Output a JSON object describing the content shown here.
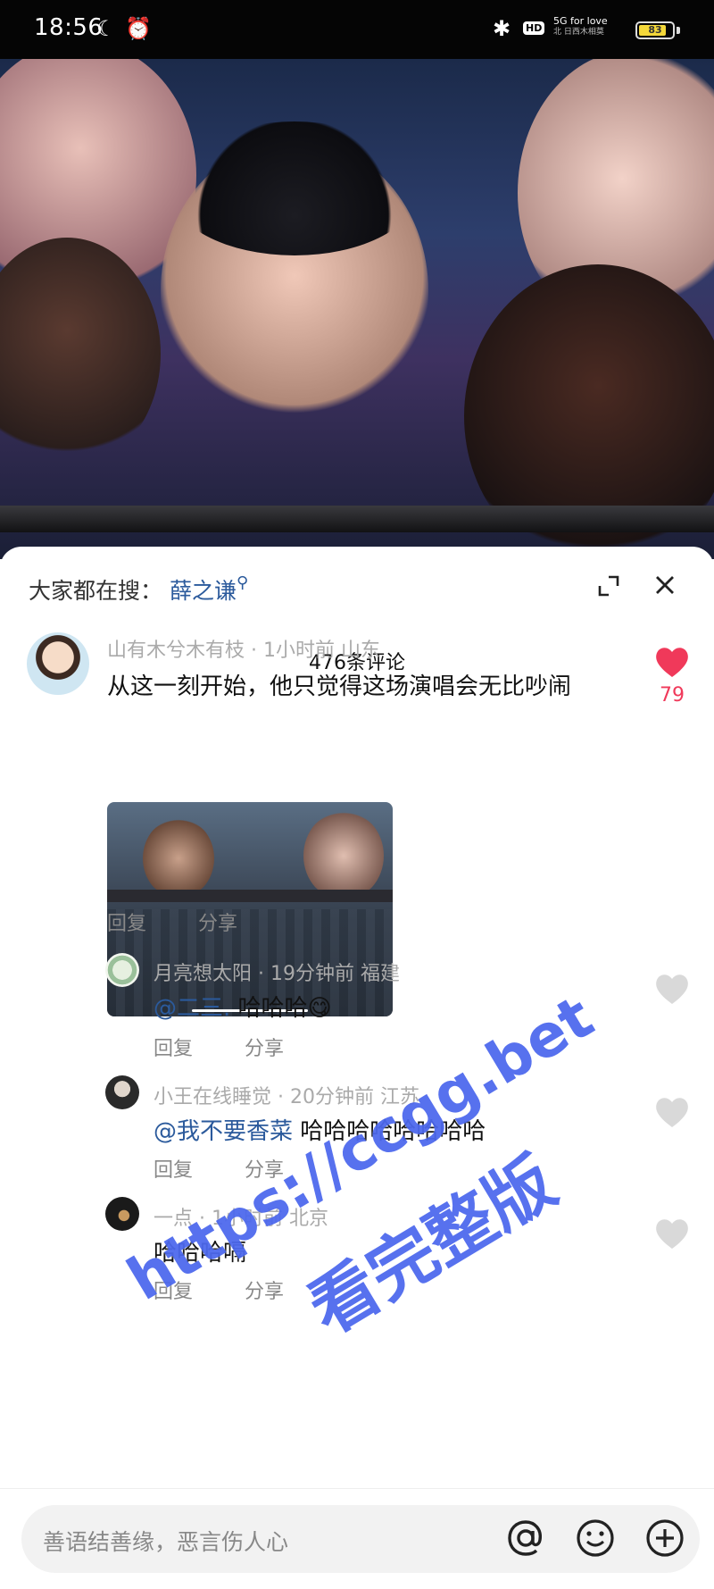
{
  "status_bar": {
    "time": "18:56",
    "hd": "HD",
    "network_top": "5G for love",
    "network_bottom": "北 日西木相莫",
    "battery": "83",
    "battery_level": 0.83
  },
  "panel": {
    "search_prefix": "大家都在搜：",
    "search_keyword": "薛之谦",
    "comment_count": "476条评论"
  },
  "comments": [
    {
      "meta": "山有木兮木有枝 · 1小时前 山东",
      "text": "从这一刻开始，他只觉得这场演唱会无比吵闹",
      "likes": "79",
      "reply": "回复",
      "share": "分享"
    }
  ],
  "replies": [
    {
      "meta": "月亮想太阳 · 19分钟前 福建",
      "mention": "@二三.",
      "text": " 哈哈哈",
      "emoji": "😋",
      "reply": "回复",
      "share": "分享"
    },
    {
      "meta": "小王在线睡觉 · 20分钟前 江苏",
      "mention": "@我不要香菜",
      "text": " 哈哈哈哈哈哈哈哈",
      "reply": "回复",
      "share": "分享"
    },
    {
      "meta": "一点 · 1小时前 北京",
      "text": "哈哈哈嗝",
      "reply": "回复",
      "share": "分享"
    }
  ],
  "watermark": {
    "url": "https://ccgg.bet",
    "slogan": "看完整版"
  },
  "input_bar": {
    "placeholder": "善语结善缘，恶言伤人心"
  },
  "colors": {
    "accent": "#2b5a9c",
    "like": "#f0395a",
    "watermark": "#3a58eb"
  }
}
